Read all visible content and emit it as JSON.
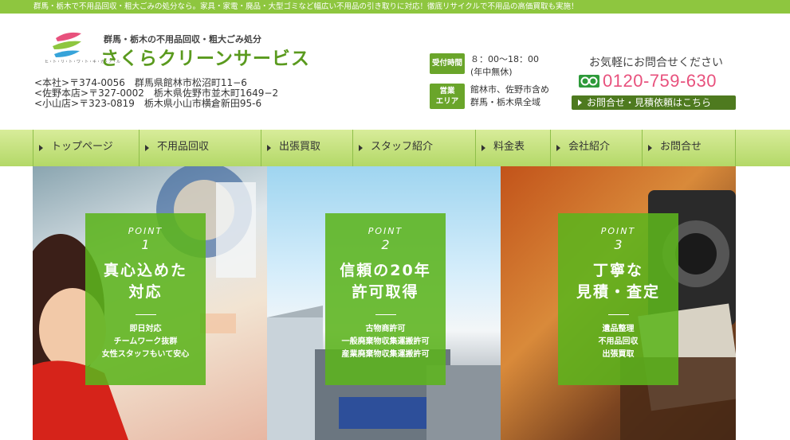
{
  "topbar": {
    "text": "群馬・栃木で不用品回収・粗大ごみの処分なら。家具・家電・廃品・大型ゴミなど幅広い不用品の引き取りに対応！徹底リサイクルで不用品の高価買取も実施！"
  },
  "logo": {
    "subtitle": "群馬・栃木の不用品回収・粗大ごみ処分",
    "name": "さくらクリーンサービス",
    "tagline": "ヒ・ト・リ・ト・ワ・ト・キ・ガ・ア・ル"
  },
  "addresses": [
    "<本社>〒374-0056　群馬県館林市松沼町11−6",
    "<佐野本店>〒327-0002　栃木県佐野市並木町1649−2",
    "<小山店>〒323-0819　栃木県小山市横倉新田95-6"
  ],
  "business": {
    "hours_badge": "受付時間",
    "hours": "８：00〜18：00",
    "closed": "(年中無休)",
    "area_badge_line1": "営業",
    "area_badge_line2": "エリア",
    "area_line1": "館林市、佐野市含め",
    "area_line2": "群馬・栃木県全域"
  },
  "contact": {
    "invite": "お気軽にお問合せください",
    "phone": "0120-759-630",
    "button": "お問合せ・見積依頼はこちら"
  },
  "nav": [
    {
      "label": "トップページ"
    },
    {
      "label": "不用品回収"
    },
    {
      "label": "出張買取"
    },
    {
      "label": "スタッフ紹介"
    },
    {
      "label": "料金表"
    },
    {
      "label": "会社紹介"
    },
    {
      "label": "お問合せ"
    }
  ],
  "points": [
    {
      "label": "POINT",
      "number": "1",
      "title_line1": "真心込めた",
      "title_line2": "対応",
      "items": [
        "即日対応",
        "チームワーク抜群",
        "女性スタッフもいて安心"
      ]
    },
    {
      "label": "POINT",
      "number": "2",
      "title_line1": "信頼の20年",
      "title_line2": "許可取得",
      "items": [
        "古物商許可",
        "一般廃棄物収集運搬許可",
        "産業廃棄物収集運搬許可"
      ]
    },
    {
      "label": "POINT",
      "number": "3",
      "title_line1": "丁寧な",
      "title_line2": "見積・査定",
      "items": [
        "遺品整理",
        "不用品回収",
        "出張買取"
      ]
    }
  ],
  "colors": {
    "brand_green": "#8ec63f",
    "logo_green": "#5a9a1e",
    "phone_pink": "#e8517d",
    "button_dark": "#4e7a1f"
  }
}
